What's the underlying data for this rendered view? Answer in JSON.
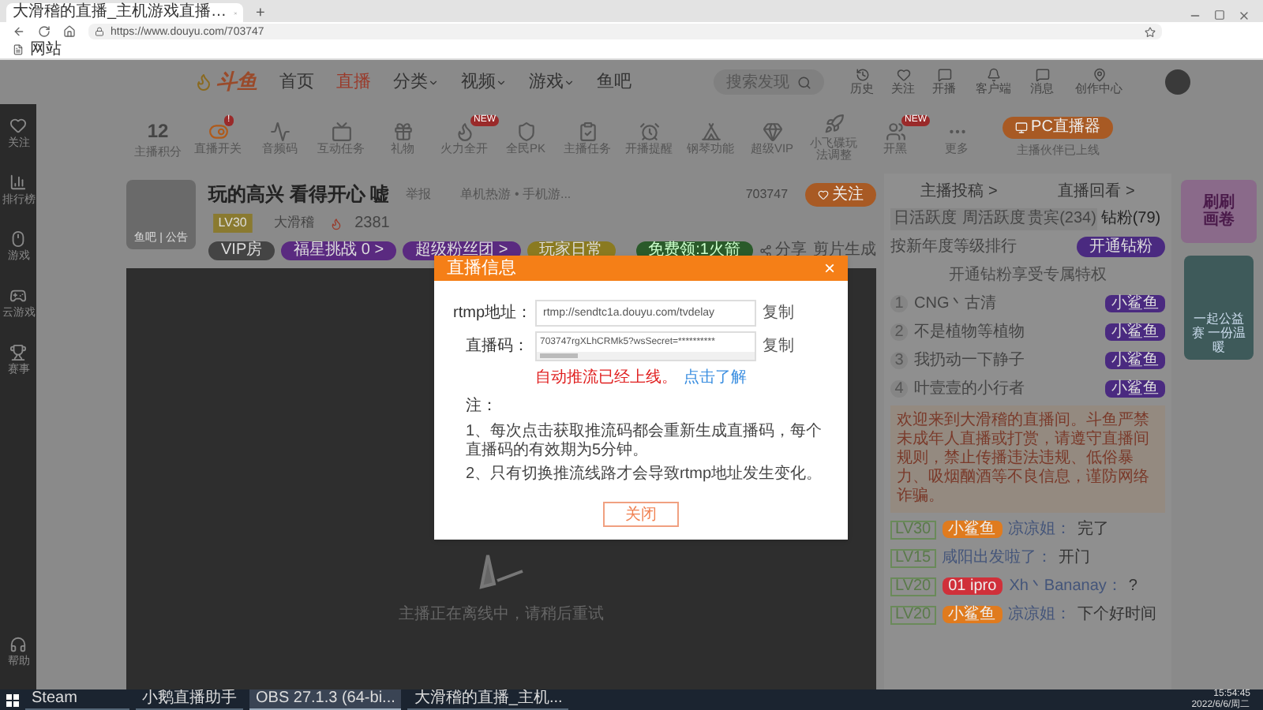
{
  "browser": {
    "tab_title": "大滑稽的直播_主机游戏直播…",
    "url": "https://www.douyu.com/703747",
    "bookmark": "网站",
    "new_tab": "+"
  },
  "sidebar": {
    "items": [
      {
        "kind": "heart",
        "label": "关注"
      },
      {
        "kind": "rank",
        "label": "排行榜"
      },
      {
        "kind": "mouse",
        "label": "游戏"
      },
      {
        "kind": "gamepad",
        "label": "云游戏"
      },
      {
        "kind": "trophy",
        "label": "赛事"
      }
    ],
    "help": "帮助"
  },
  "nav": {
    "logo": "斗鱼",
    "items": [
      {
        "label": "首页",
        "selected": false,
        "dropdown": false
      },
      {
        "label": "直播",
        "selected": true,
        "dropdown": false
      },
      {
        "label": "分类",
        "selected": false,
        "dropdown": true
      },
      {
        "label": "视频",
        "selected": false,
        "dropdown": true
      },
      {
        "label": "游戏",
        "selected": false,
        "dropdown": true
      },
      {
        "label": "鱼吧",
        "selected": false,
        "dropdown": false
      }
    ],
    "search_placeholder": "搜索发现",
    "tools": [
      {
        "kind": "clock",
        "label": "历史"
      },
      {
        "kind": "heart",
        "label": "关注"
      },
      {
        "kind": "chat",
        "label": "开播"
      },
      {
        "kind": "bell",
        "label": "客户端"
      },
      {
        "kind": "message",
        "label": "消息"
      },
      {
        "kind": "pin",
        "label": "创作中心"
      }
    ]
  },
  "toolbar": {
    "score": "12",
    "score_label": "主播积分",
    "items": [
      {
        "kind": "toggle",
        "label": "直播开关",
        "badge": "!"
      },
      {
        "kind": "wave",
        "label": "音频码"
      },
      {
        "kind": "ad",
        "label": "互动任务"
      },
      {
        "kind": "gift",
        "label": "礼物"
      },
      {
        "kind": "flame",
        "label": "火力全开",
        "badge": "NEW"
      },
      {
        "kind": "shield",
        "label": "全民PK"
      },
      {
        "kind": "task",
        "label": "主播任务"
      },
      {
        "kind": "alarm",
        "label": "开播提醒"
      },
      {
        "kind": "tent",
        "label": "钢琴功能"
      },
      {
        "kind": "gem",
        "label": "超级VIP"
      },
      {
        "kind": "ufo",
        "label": "小飞碟玩法调整"
      },
      {
        "kind": "users",
        "label": "开黑",
        "badge": "NEW"
      },
      {
        "kind": "more",
        "label": "更多"
      }
    ],
    "pc_button": "PC直播器",
    "pc_note": "主播伙伴已上线"
  },
  "room": {
    "title": "玩的高兴 看得开心 嘘",
    "report": "举报",
    "category": "单机热游 • 手机游...",
    "level": "LV30",
    "name": "大滑稽",
    "heat": "2381",
    "avatar_caption": "鱼吧 | 公告",
    "room_id": "703747",
    "follow": "关注",
    "tags": [
      "VIP房",
      "福星挑战 0 >",
      "超级粉丝团 >",
      "玩家日常"
    ],
    "free_gift": "免费领:1火箭",
    "share": "分享",
    "clip": "剪片生成"
  },
  "video": {
    "message": "主播正在离线中，请稍后重试"
  },
  "modal": {
    "title": "直播信息",
    "close_mark": "×",
    "rtmp_label": "rtmp地址：",
    "rtmp_value": "rtmp://sendtc1a.douyu.com/tvdelay",
    "key_label": "直播码：",
    "key_value": "703747rgXLhCRMk5?wsSecret=**********",
    "copy": "复制",
    "copy_2": "复制",
    "auto_note": "自动推流已经上线。",
    "auto_link": "点击了解",
    "note_title": "注：",
    "notes": [
      "1、每次点击获取推流码都会重新生成直播码，每个直播码的有效期为5分钟。",
      "2、只有切换推流线路才会导致rtmp地址发生变化。"
    ],
    "close_button": "关闭"
  },
  "panel": {
    "links": [
      "主播投稿 >",
      "直播回看 >"
    ],
    "tabs": [
      {
        "label": "日活跃度",
        "selected": false
      },
      {
        "label": "周活跃度",
        "selected": false
      },
      {
        "label": "贵宾(234)",
        "selected": false
      },
      {
        "label": "钻粉(79)",
        "selected": true
      }
    ],
    "rank_title": "按新年度等级排行",
    "open_button": "开通钻粉",
    "hint": "开通钻粉享受专属特权",
    "ranks": [
      {
        "num": "1",
        "name": "CNG丶古清",
        "badge": "小鲨鱼"
      },
      {
        "num": "2",
        "name": "不是植物等植物",
        "badge": "小鲨鱼"
      },
      {
        "num": "3",
        "name": "我扔动一下静子",
        "badge": "小鲨鱼"
      },
      {
        "num": "4",
        "name": "叶壹壹的小行者",
        "badge": "小鲨鱼"
      }
    ],
    "notice": "欢迎来到大滑稽的直播间。斗鱼严禁未成年人直播或打赏，请遵守直播间规则，禁止传播违法违规、低俗暴力、吸烟酗酒等不良信息，谨防网络诈骗。",
    "chat": [
      {
        "level": "LV30",
        "badge": "小鲨鱼",
        "color": "#e07b1e",
        "user": "凉凉姐：",
        "text": "完了"
      },
      {
        "level": "LV15",
        "user": "咸阳出发啦了：",
        "text": "开门"
      },
      {
        "level": "LV20",
        "badge": "01 ipro",
        "color": "#d0303a",
        "user": "Xh丶Bananay：",
        "text": "?"
      },
      {
        "level": "LV20",
        "badge": "小鲨鱼",
        "color": "#e07b1e",
        "user": "凉凉姐：",
        "text": "下个好时间"
      }
    ]
  },
  "ads": {
    "banner_text": "刷刷画卷",
    "card_text": "一起公益赛 一份温暖"
  },
  "taskbar": {
    "apps": [
      {
        "label": "Steam",
        "selected": false
      },
      {
        "label": "小鹅直播助手",
        "selected": false
      },
      {
        "label": "OBS 27.1.3 (64-bi...",
        "selected": true
      },
      {
        "label": "大滑稽的直播_主机...",
        "selected": false
      }
    ],
    "time": "15:54:45",
    "date": "2022/6/6/周二"
  }
}
